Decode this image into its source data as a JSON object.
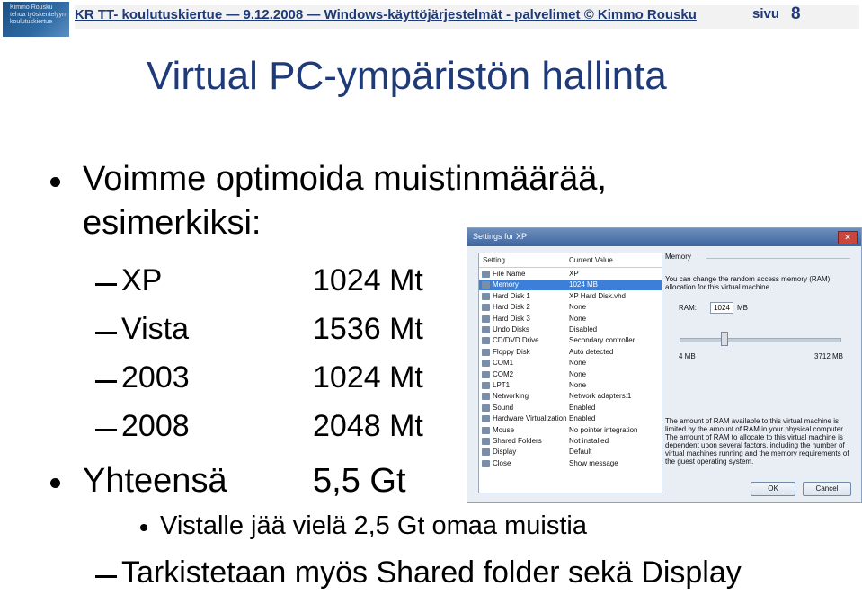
{
  "header": {
    "logo_lines": [
      "Kimmo Rousku",
      "tehoa työskentelyyn",
      "koulutuskiertue"
    ],
    "text": "KR TT- koulutuskiertue — 9.12.2008 — Windows-käyttöjärjestelmät - palvelimet © Kimmo Rousku",
    "page_label": "sivu",
    "page_number": "8"
  },
  "title": "Virtual PC-ympäristön hallinta",
  "bullets": {
    "b1_line1": "Voimme optimoida muistinmäärää,",
    "b1_line2": "esimerkiksi:",
    "items": [
      {
        "name": "XP",
        "value": "1024 Mt"
      },
      {
        "name": "Vista",
        "value": "1536 Mt"
      },
      {
        "name": "2003",
        "value": "1024 Mt"
      },
      {
        "name": "2008",
        "value": "2048 Mt"
      }
    ],
    "total_label": "Yhteensä",
    "total_value": "5,5 Gt",
    "sub_bullet": "Vistalle jää vielä 2,5 Gt omaa muistia",
    "last_dash": "Tarkistetaan myös Shared folder sekä Display"
  },
  "dialog": {
    "title": "Settings for XP",
    "col_setting": "Setting",
    "col_value": "Current Value",
    "rows": [
      {
        "name": "File Name",
        "value": "XP"
      },
      {
        "name": "Memory",
        "value": "1024 MB"
      },
      {
        "name": "Hard Disk 1",
        "value": "XP Hard Disk.vhd"
      },
      {
        "name": "Hard Disk 2",
        "value": "None"
      },
      {
        "name": "Hard Disk 3",
        "value": "None"
      },
      {
        "name": "Undo Disks",
        "value": "Disabled"
      },
      {
        "name": "CD/DVD Drive",
        "value": "Secondary controller"
      },
      {
        "name": "Floppy Disk",
        "value": "Auto detected"
      },
      {
        "name": "COM1",
        "value": "None"
      },
      {
        "name": "COM2",
        "value": "None"
      },
      {
        "name": "LPT1",
        "value": "None"
      },
      {
        "name": "Networking",
        "value": "Network adapters:1"
      },
      {
        "name": "Sound",
        "value": "Enabled"
      },
      {
        "name": "Hardware Virtualization",
        "value": "Enabled"
      },
      {
        "name": "Mouse",
        "value": "No pointer integration"
      },
      {
        "name": "Shared Folders",
        "value": "Not installed"
      },
      {
        "name": "Display",
        "value": "Default"
      },
      {
        "name": "Close",
        "value": "Show message"
      }
    ],
    "selected_row": 1,
    "section": "Memory",
    "desc1": "You can change the random access memory (RAM) allocation for this virtual machine.",
    "ram_label": "RAM:",
    "ram_value": "1024",
    "ram_unit": "MB",
    "min_label": "4 MB",
    "max_label": "3712 MB",
    "slider_fraction": 0.275,
    "desc2": "The amount of RAM available to this virtual machine is limited by the amount of RAM in your physical computer. The amount of RAM to allocate to this virtual machine is dependent upon several factors, including the number of virtual machines running and the memory requirements of the guest operating system.",
    "ok": "OK",
    "cancel": "Cancel"
  }
}
